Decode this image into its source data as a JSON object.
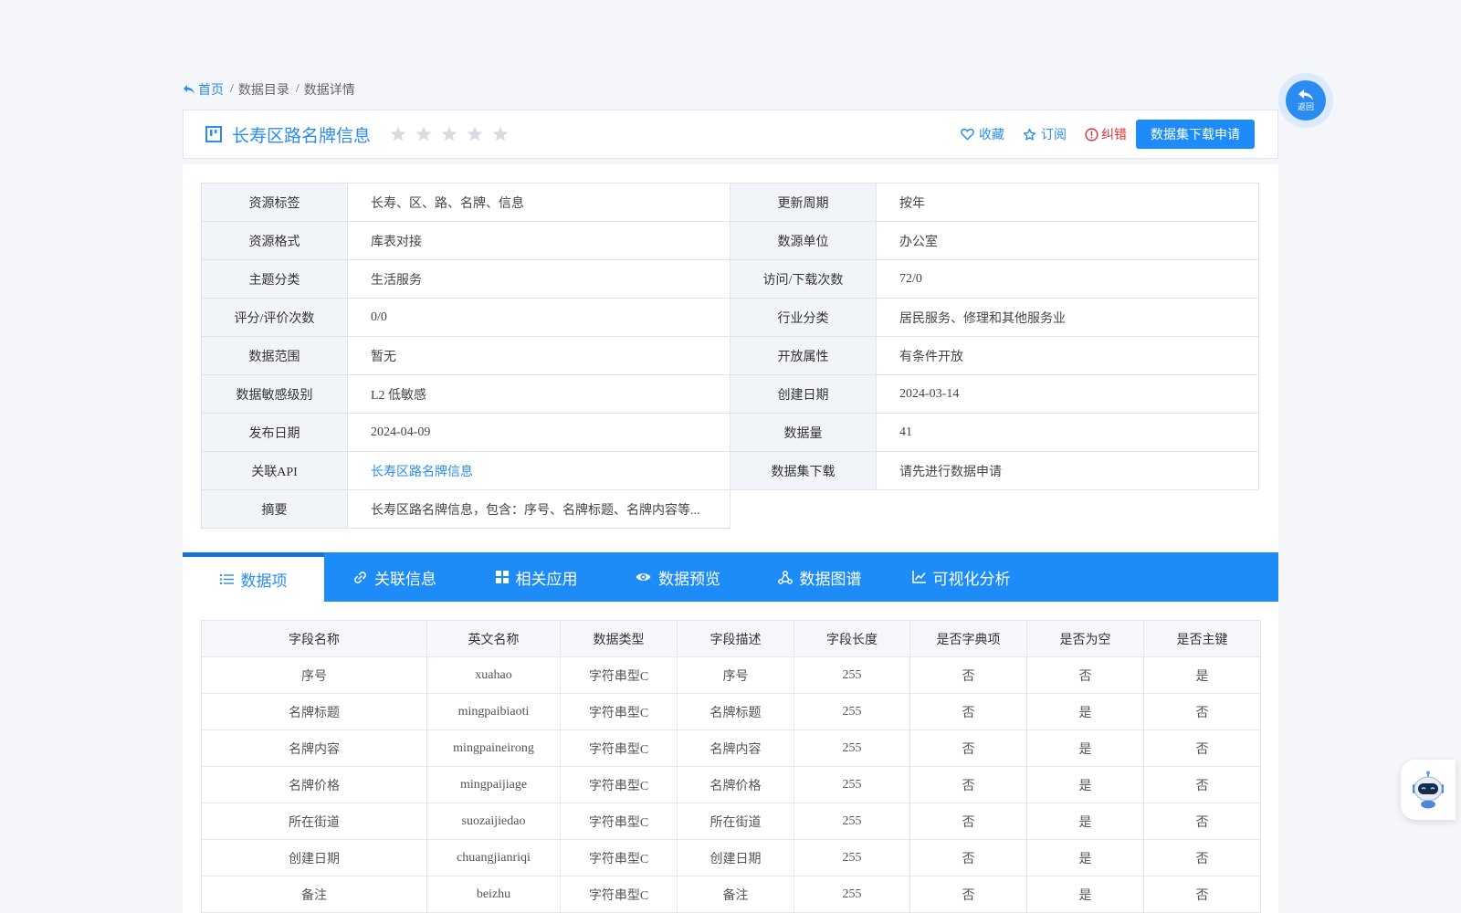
{
  "breadcrumb": {
    "home": "首页",
    "items": [
      "数据目录",
      "数据详情"
    ],
    "separator": "/"
  },
  "dataset": {
    "title": "长寿区路名牌信息",
    "rating": 0,
    "rating_max": 5
  },
  "actions": {
    "favorite": "收藏",
    "subscribe": "订阅",
    "report_error": "纠错",
    "apply_download": "数据集下载申请"
  },
  "info": [
    {
      "label": "资源标签",
      "value": "长寿、区、路、名牌、信息",
      "label2": "更新周期",
      "value2": "按年"
    },
    {
      "label": "资源格式",
      "value": "库表对接",
      "label2": "数源单位",
      "value2": "办公室"
    },
    {
      "label": "主题分类",
      "value": "生活服务",
      "label2": "访问/下载次数",
      "value2": "72/0"
    },
    {
      "label": "评分/评价次数",
      "value": "0/0",
      "label2": "行业分类",
      "value2": "居民服务、修理和其他服务业"
    },
    {
      "label": "数据范围",
      "value": "暂无",
      "label2": "开放属性",
      "value2": "有条件开放"
    },
    {
      "label": "数据敏感级别",
      "value": "L2 低敏感",
      "label2": "创建日期",
      "value2": "2024-03-14"
    },
    {
      "label": "发布日期",
      "value": "2024-04-09",
      "label2": "数据量",
      "value2": "41"
    },
    {
      "label": "关联API",
      "value": "长寿区路名牌信息",
      "label2": "数据集下载",
      "value2": "请先进行数据申请"
    },
    {
      "label": "摘要",
      "value": "长寿区路名牌信息，包含：序号、名牌标题、名牌内容等..."
    }
  ],
  "tabs": [
    {
      "label": "数据项",
      "icon": "list-icon",
      "active": true
    },
    {
      "label": "关联信息",
      "icon": "link-icon",
      "active": false
    },
    {
      "label": "相关应用",
      "icon": "grid-icon",
      "active": false
    },
    {
      "label": "数据预览",
      "icon": "eye-icon",
      "active": false
    },
    {
      "label": "数据图谱",
      "icon": "graph-icon",
      "active": false
    },
    {
      "label": "可视化分析",
      "icon": "chart-icon",
      "active": false
    }
  ],
  "fields": {
    "headers": [
      "字段名称",
      "英文名称",
      "数据类型",
      "字段描述",
      "字段长度",
      "是否字典项",
      "是否为空",
      "是否主键"
    ],
    "rows": [
      [
        "序号",
        "xuahao",
        "字符串型C",
        "序号",
        "255",
        "否",
        "否",
        "是"
      ],
      [
        "名牌标题",
        "mingpaibiaoti",
        "字符串型C",
        "名牌标题",
        "255",
        "否",
        "是",
        "否"
      ],
      [
        "名牌内容",
        "mingpaineirong",
        "字符串型C",
        "名牌内容",
        "255",
        "否",
        "是",
        "否"
      ],
      [
        "名牌价格",
        "mingpaijiage",
        "字符串型C",
        "名牌价格",
        "255",
        "否",
        "是",
        "否"
      ],
      [
        "所在街道",
        "suozaijiedao",
        "字符串型C",
        "所在街道",
        "255",
        "否",
        "是",
        "否"
      ],
      [
        "创建日期",
        "chuangjianriqi",
        "字符串型C",
        "创建日期",
        "255",
        "否",
        "是",
        "否"
      ],
      [
        "备注",
        "beizhu",
        "字符串型C",
        "备注",
        "255",
        "否",
        "是",
        "否"
      ]
    ]
  },
  "floating": {
    "back_label": "返回"
  },
  "colors": {
    "primary": "#1d8cf8",
    "link": "#2a8cf0",
    "error": "#e0303a",
    "label_bg": "#f1f5f9",
    "star": "#d9dde3"
  }
}
